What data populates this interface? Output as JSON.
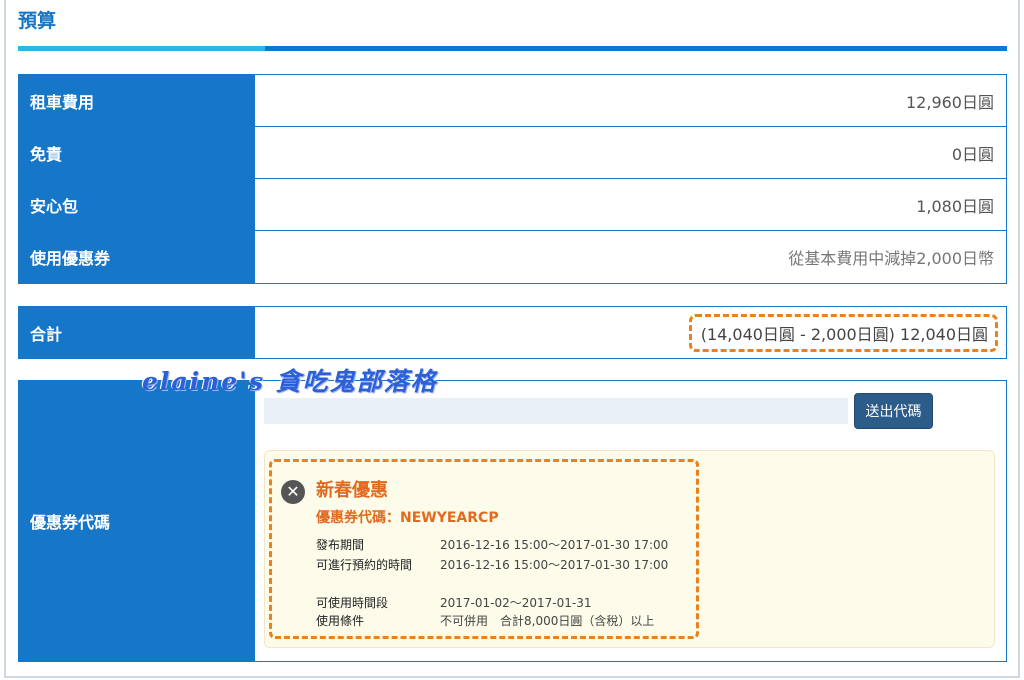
{
  "section": {
    "title": "預算"
  },
  "rows": [
    {
      "label": "租車費用",
      "value": "12,960日圓"
    },
    {
      "label": "免責",
      "value": "0日圓"
    },
    {
      "label": "安心包",
      "value": "1,080日圓"
    },
    {
      "label": "使用優惠券",
      "value": "從基本費用中減掉2,000日幣"
    }
  ],
  "total": {
    "label": "合計",
    "value": "(14,040日圓 - 2,000日圓) 12,040日圓"
  },
  "coupon": {
    "label": "優惠券代碼",
    "input_value": "",
    "submit_label": "送出代碼",
    "name": "新春優惠",
    "code_line": "優惠券代碼：NEWYEARCP",
    "details": [
      {
        "key": "發布期間",
        "value": "2016-12-16 15:00～2017-01-30 17:00"
      },
      {
        "key": "可進行預約的時間",
        "value": "2016-12-16 15:00～2017-01-30 17:00"
      },
      {
        "key": "可使用時間段",
        "value": "2017-01-02～2017-01-31"
      },
      {
        "key": "使用條件",
        "value": "不可併用　合計8,000日圓（含稅）以上"
      }
    ]
  },
  "watermark": "elaine's 貪吃鬼部落格",
  "colors": {
    "primary": "#1676c8",
    "accent_light": "#33b3e6",
    "highlight": "#e8821e",
    "coupon_text": "#e26a1f"
  },
  "icons": {
    "remove": "close-icon"
  }
}
